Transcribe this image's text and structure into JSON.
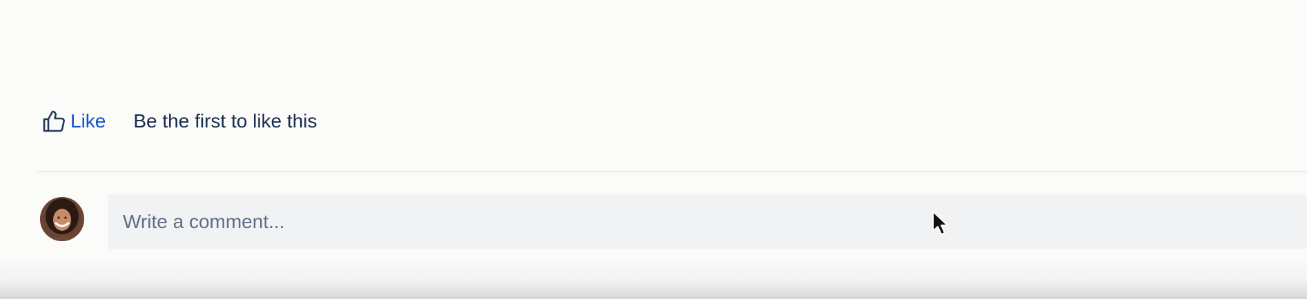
{
  "like": {
    "label": "Like",
    "summary": "Be the first to like this",
    "icon": "thumbs-up-icon"
  },
  "comment": {
    "placeholder": "Write a comment...",
    "avatar": "user-avatar"
  },
  "colors": {
    "link": "#0c54c8",
    "text": "#172b4d",
    "placeholder": "#5e6c84",
    "input_bg": "#f1f2f4",
    "divider": "#d5dbe5"
  }
}
